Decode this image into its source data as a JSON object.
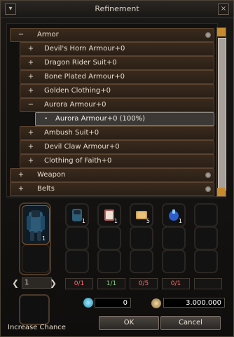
{
  "window": {
    "title": "Refinement"
  },
  "tree": [
    {
      "sign": "−",
      "label": "Armor",
      "type": "top",
      "knob": true
    },
    {
      "sign": "+",
      "label": "Devil's Horn Armour+0",
      "type": "child"
    },
    {
      "sign": "+",
      "label": "Dragon Rider Suit+0",
      "type": "child"
    },
    {
      "sign": "+",
      "label": "Bone Plated Armour+0",
      "type": "child"
    },
    {
      "sign": "+",
      "label": "Golden Clothing+0",
      "type": "child"
    },
    {
      "sign": "−",
      "label": "Aurora Armour+0",
      "type": "child"
    },
    {
      "sign": "•",
      "label": "Aurora Armour+0 (100%)",
      "type": "leaf"
    },
    {
      "sign": "+",
      "label": "Ambush Suit+0",
      "type": "child"
    },
    {
      "sign": "+",
      "label": "Devil Claw Armour+0",
      "type": "child"
    },
    {
      "sign": "+",
      "label": "Clothing of Faith+0",
      "type": "child"
    },
    {
      "sign": "+",
      "label": "Weapon",
      "type": "top",
      "knob": true
    },
    {
      "sign": "+",
      "label": "Belts",
      "type": "top",
      "knob": true
    }
  ],
  "main_slot": {
    "qty": "1"
  },
  "slots": {
    "row1": [
      {
        "name": "armor-piece-icon",
        "qty": "1"
      },
      {
        "name": "book-icon",
        "qty": "1"
      },
      {
        "name": "gold-ingot-icon",
        "qty": "5"
      },
      {
        "name": "blue-potion-icon",
        "qty": "1"
      },
      {
        "name": "empty-slot",
        "qty": ""
      }
    ]
  },
  "pager": {
    "page": "1"
  },
  "counters": [
    "0/1",
    "1/1",
    "0/5",
    "0/1"
  ],
  "increase_chance": {
    "label": "Increase Chance"
  },
  "costs": {
    "jewel_value": "0",
    "gold_value": "3.000.000"
  },
  "buttons": {
    "ok": "OK",
    "cancel": "Cancel"
  },
  "colors": {
    "accent": "#c88a2e",
    "row_bg": "#3a2a1d",
    "leaf_bg": "#3b3835",
    "counter_ok": "#7fd07b",
    "counter_bad": "#ff6a6a"
  }
}
